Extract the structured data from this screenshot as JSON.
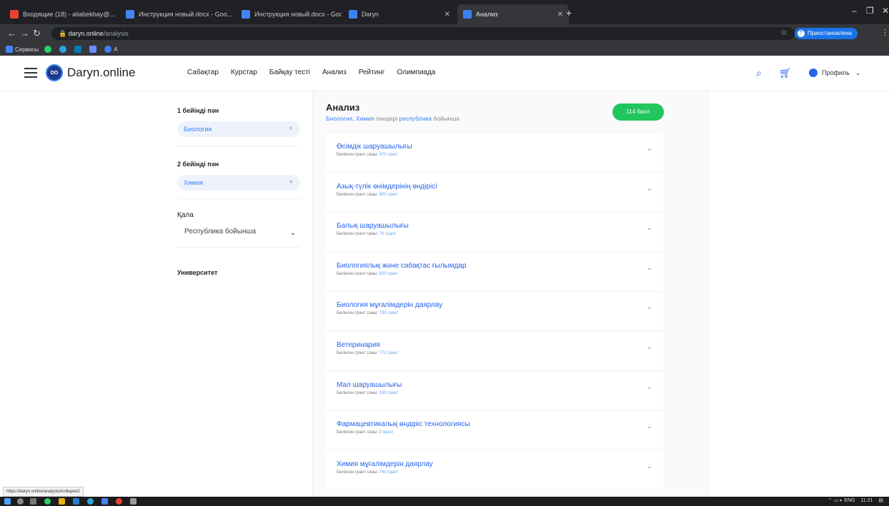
{
  "browser": {
    "tabs": [
      {
        "label": "Входящие (18) - aliabekbay@...",
        "color": "#ea4335",
        "active": false
      },
      {
        "label": "Инструкция новый.docx - Goo...",
        "color": "#4285f4",
        "active": false
      },
      {
        "label": "Инструкция новый.docx - Goo...",
        "color": "#4285f4",
        "active": false
      },
      {
        "label": "Daryn",
        "color": "#3b82f6",
        "active": false
      },
      {
        "label": "Анализ",
        "color": "#3b82f6",
        "active": true
      }
    ],
    "address": {
      "host": "daryn.online",
      "path": "/analysis"
    },
    "profile_paused": "Приостановлена",
    "profile_initial": "T",
    "bookmarks": {
      "services": "Сервисы",
      "last": "A"
    }
  },
  "site": {
    "logo_mark": "DO",
    "logo_name": "Daryn.online",
    "nav": [
      "Сабақтар",
      "Курстар",
      "Байқау тесті",
      "Анализ",
      "Рейтинг",
      "Олимпиада"
    ],
    "profile_label": "Профиль"
  },
  "filters": {
    "subject1_label": "1 бейінді пән",
    "subject1_value": "Биология",
    "subject2_label": "2 бейінді пән",
    "subject2_value": "Химия",
    "city_label": "Қала",
    "city_value": "Республика бойынша",
    "university_label": "Университет",
    "clear_glyph": "×",
    "chevron_glyph": "⌄"
  },
  "analysis": {
    "title": "Анализ",
    "subtitle_pre": "Биология, Химия",
    "subtitle_mid": " пәндері ",
    "subtitle_region": "республика",
    "subtitle_post": " бойынша",
    "score": "114 балл",
    "meta_label": "Бөлінген грант саны:",
    "rows": [
      {
        "title": "Өсімдік шаруашылығы",
        "grants": "470 грант"
      },
      {
        "title": "Азық-түлік өнімдерінің өндірісі",
        "grants": "800 грант"
      },
      {
        "title": "Балық шаруашылығы",
        "grants": "70 грант"
      },
      {
        "title": "Биологиялық және сабақтас ғылымдар",
        "grants": "650 грант"
      },
      {
        "title": "Биология мұғалімдерін даярлау",
        "grants": "730 грант"
      },
      {
        "title": "Ветеринария",
        "grants": "772 грант"
      },
      {
        "title": "Мал шаруашылығы",
        "grants": "150 грант"
      },
      {
        "title": "Фармацевтикалық өндіріс технологиясы",
        "grants": "0 грант"
      },
      {
        "title": "Химия мұғалімдерін даярлау",
        "grants": "740 грант"
      }
    ]
  },
  "status_url": "https://daryn.online/analysis#collapse2",
  "taskbar": {
    "lang": "ENG",
    "time": "11:21"
  }
}
